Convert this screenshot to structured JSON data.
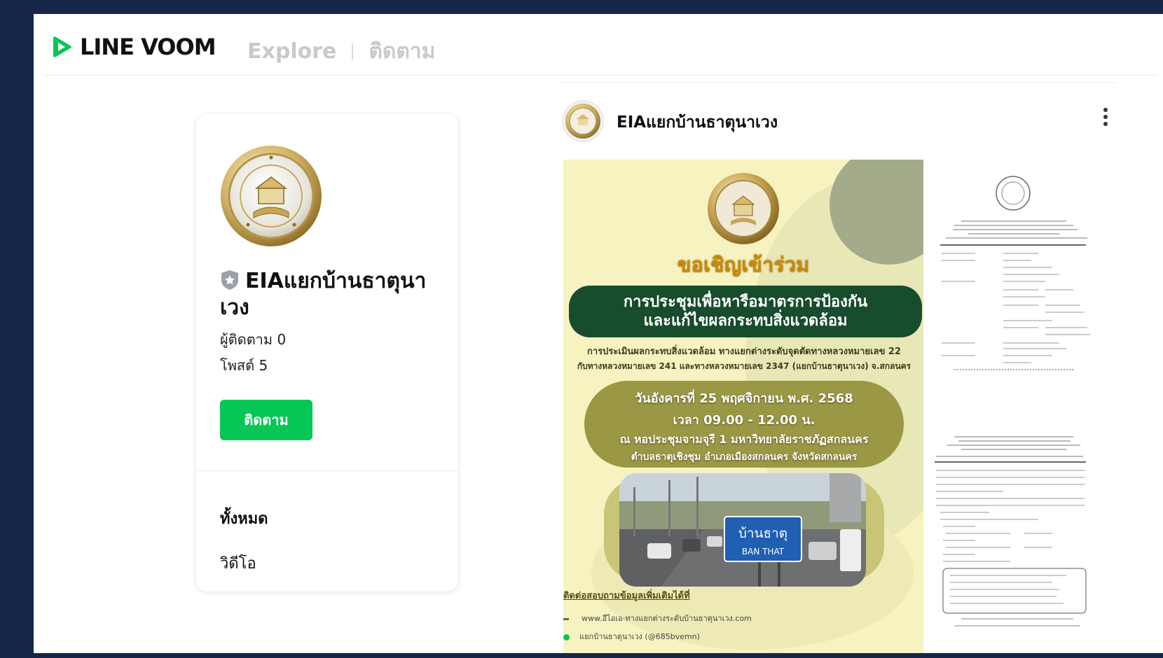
{
  "header": {
    "brand": "LINE VOOM",
    "nav_explore": "Explore",
    "nav_following": "ติดตาม"
  },
  "profile": {
    "name": "EIAแยกบ้านธาตุนาเวง",
    "followers_label": "ผู้ติดตาม 0",
    "posts_label": "โพสต์ 5",
    "follow_button": "ติดตาม",
    "tabs": [
      {
        "label": "ทั้งหมด",
        "active": true
      },
      {
        "label": "วิดีโอ",
        "active": false
      }
    ]
  },
  "post": {
    "author": "EIAแยกบ้านธาตุนาเวง",
    "poster": {
      "invite": "ขอเชิญเข้าร่วม",
      "meeting_title_line1": "การประชุมเพื่อหารือมาตรการป้องกัน",
      "meeting_title_line2": "และแก้ไขผลกระทบสิ่งแวดล้อม",
      "desc_line1": "การประเมินผลกระทบสิ่งแวดล้อม ทางแยกต่างระดับจุดตัดทางหลวงหมายเลข 22",
      "desc_line2": "กับทางหลวงหมายเลข 241 และทางหลวงหมายเลข 2347 (แยกบ้านธาตุนาเวง) จ.สกลนคร",
      "date": "วันอังคารที่ 25 พฤศจิกายน พ.ศ. 2568",
      "time": "เวลา 09.00 - 12.00 น.",
      "venue": "ณ หอประชุมจามจุรี 1 มหาวิทยาลัยราชภัฏสกลนคร",
      "address": "ตำบลธาตุเชิงชุม อำเภอเมืองสกลนคร จังหวัดสกลนคร",
      "sign_thai": "บ้านธาตุ",
      "sign_en": "BAN THAT",
      "contact_title": "ติดต่อสอบถามข้อมูลเพิ่มเติมได้ที่",
      "contact_web": "www.อีไอเอ-ทางแยกต่างระดับบ้านธาตุนาเวง.com",
      "contact_line": "แยกบ้านธาตุนาเวง (@685bvemn)"
    }
  },
  "colors": {
    "frame_bg": "#16264a",
    "line_green": "#06c755",
    "poster_dark_green": "#174c2c",
    "poster_olive": "#9b9845",
    "poster_gold": "#c78b09"
  },
  "icons": {
    "logo": "line-voom-logo-icon",
    "badge": "shield-star-icon",
    "more": "more-vertical-icon"
  }
}
